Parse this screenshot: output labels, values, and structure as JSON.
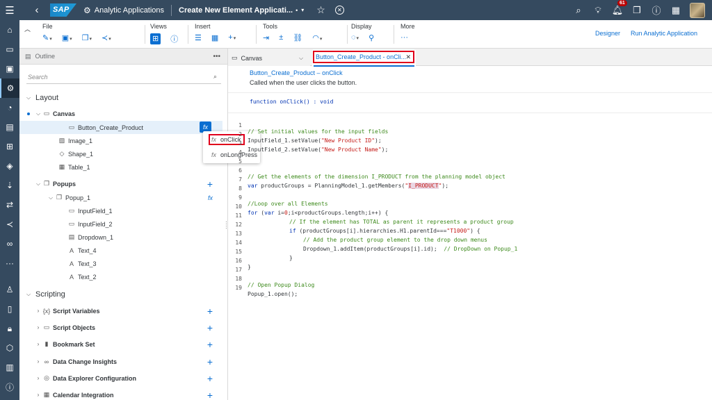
{
  "shell": {
    "back_icon": "back-arrow-icon",
    "logo": "SAP",
    "app_name": "Analytic Applications",
    "doc_title": "Create New Element Applicati...",
    "doc_dot": "•",
    "notifications_count": "61"
  },
  "toolbar": {
    "file_label": "File",
    "views_label": "Views",
    "insert_label": "Insert",
    "tools_label": "Tools",
    "display_label": "Display",
    "more_label": "More",
    "designer_label": "Designer",
    "run_label": "Run Analytic Application"
  },
  "outline": {
    "title": "Outline",
    "search_placeholder": "Search",
    "layout_label": "Layout",
    "canvas_label": "Canvas",
    "items": {
      "button_create_product": "Button_Create_Product",
      "image_1": "Image_1",
      "shape_1": "Shape_1",
      "table_1": "Table_1",
      "popups": "Popups",
      "popup_1": "Popup_1",
      "inputfield_1": "InputField_1",
      "inputfield_2": "InputField_2",
      "dropdown_1": "Dropdown_1",
      "text_4": "Text_4",
      "text_3": "Text_3",
      "text_2": "Text_2"
    },
    "scripting_label": "Scripting",
    "scripting": {
      "script_variables": "Script Variables",
      "script_objects": "Script Objects",
      "bookmark_set": "Bookmark Set",
      "data_change_insights": "Data Change Insights",
      "data_explorer_configuration": "Data Explorer Configuration",
      "calendar_integration": "Calendar Integration"
    }
  },
  "popover": {
    "fx": "fx",
    "on_click": "onClick",
    "on_long_press": "onLongPress"
  },
  "editor": {
    "canvas_tab": "Canvas",
    "script_tab": "Button_Create_Product - onCli...",
    "script_title": "Button_Create_Product – onClick",
    "script_desc": "Called when the user clicks the button.",
    "signature": "function onClick() : void",
    "line_numbers": [
      "1",
      "2",
      "3",
      "4",
      "5",
      "6",
      "7",
      "8",
      "9",
      "10",
      "11",
      "12",
      "13",
      "14",
      "15",
      "16",
      "17",
      "18",
      "19"
    ],
    "lines": {
      "l1": "// Set initial values for the input fields",
      "l2a": "InputField_1.setValue(",
      "l2b": "\"New Product ID\"",
      "l2c": ");",
      "l3a": "InputField_2.setValue(",
      "l3b": "\"New Product Name\"",
      "l3c": ");",
      "l6": "// Get the elements of the dimension I_PRODUCT from the planning model object",
      "l7a": "var",
      "l7b": " productGroups = PlanningModel_1.getMembers(",
      "l7c": "\"",
      "l7d": "I_PRODUCT",
      "l7e": "\"",
      "l7f": ");",
      "l9": "//Loop over all Elements",
      "l10a": "for",
      "l10b": " (",
      "l10c": "var",
      "l10d": " i=",
      "l10e": "0",
      "l10f": ";i<productGroups.length;i++) {",
      "l11": "// If the element has TOTAL as parent it represents a product group",
      "l12a": "if",
      "l12b": " (productGroups[i].hierarchies.H1.parentId===",
      "l12c": "\"T1000\"",
      "l12d": ") {",
      "l13": "// Add the product group element to the drop down menus",
      "l14a": "Dropdown_1.addItem(productGroups[i].id);  ",
      "l14b": "// DropDown on Popup_1",
      "l15": "}",
      "l16": "}",
      "l18": "// Open Popup Dialog",
      "l19": "Popup_1.open();"
    }
  }
}
